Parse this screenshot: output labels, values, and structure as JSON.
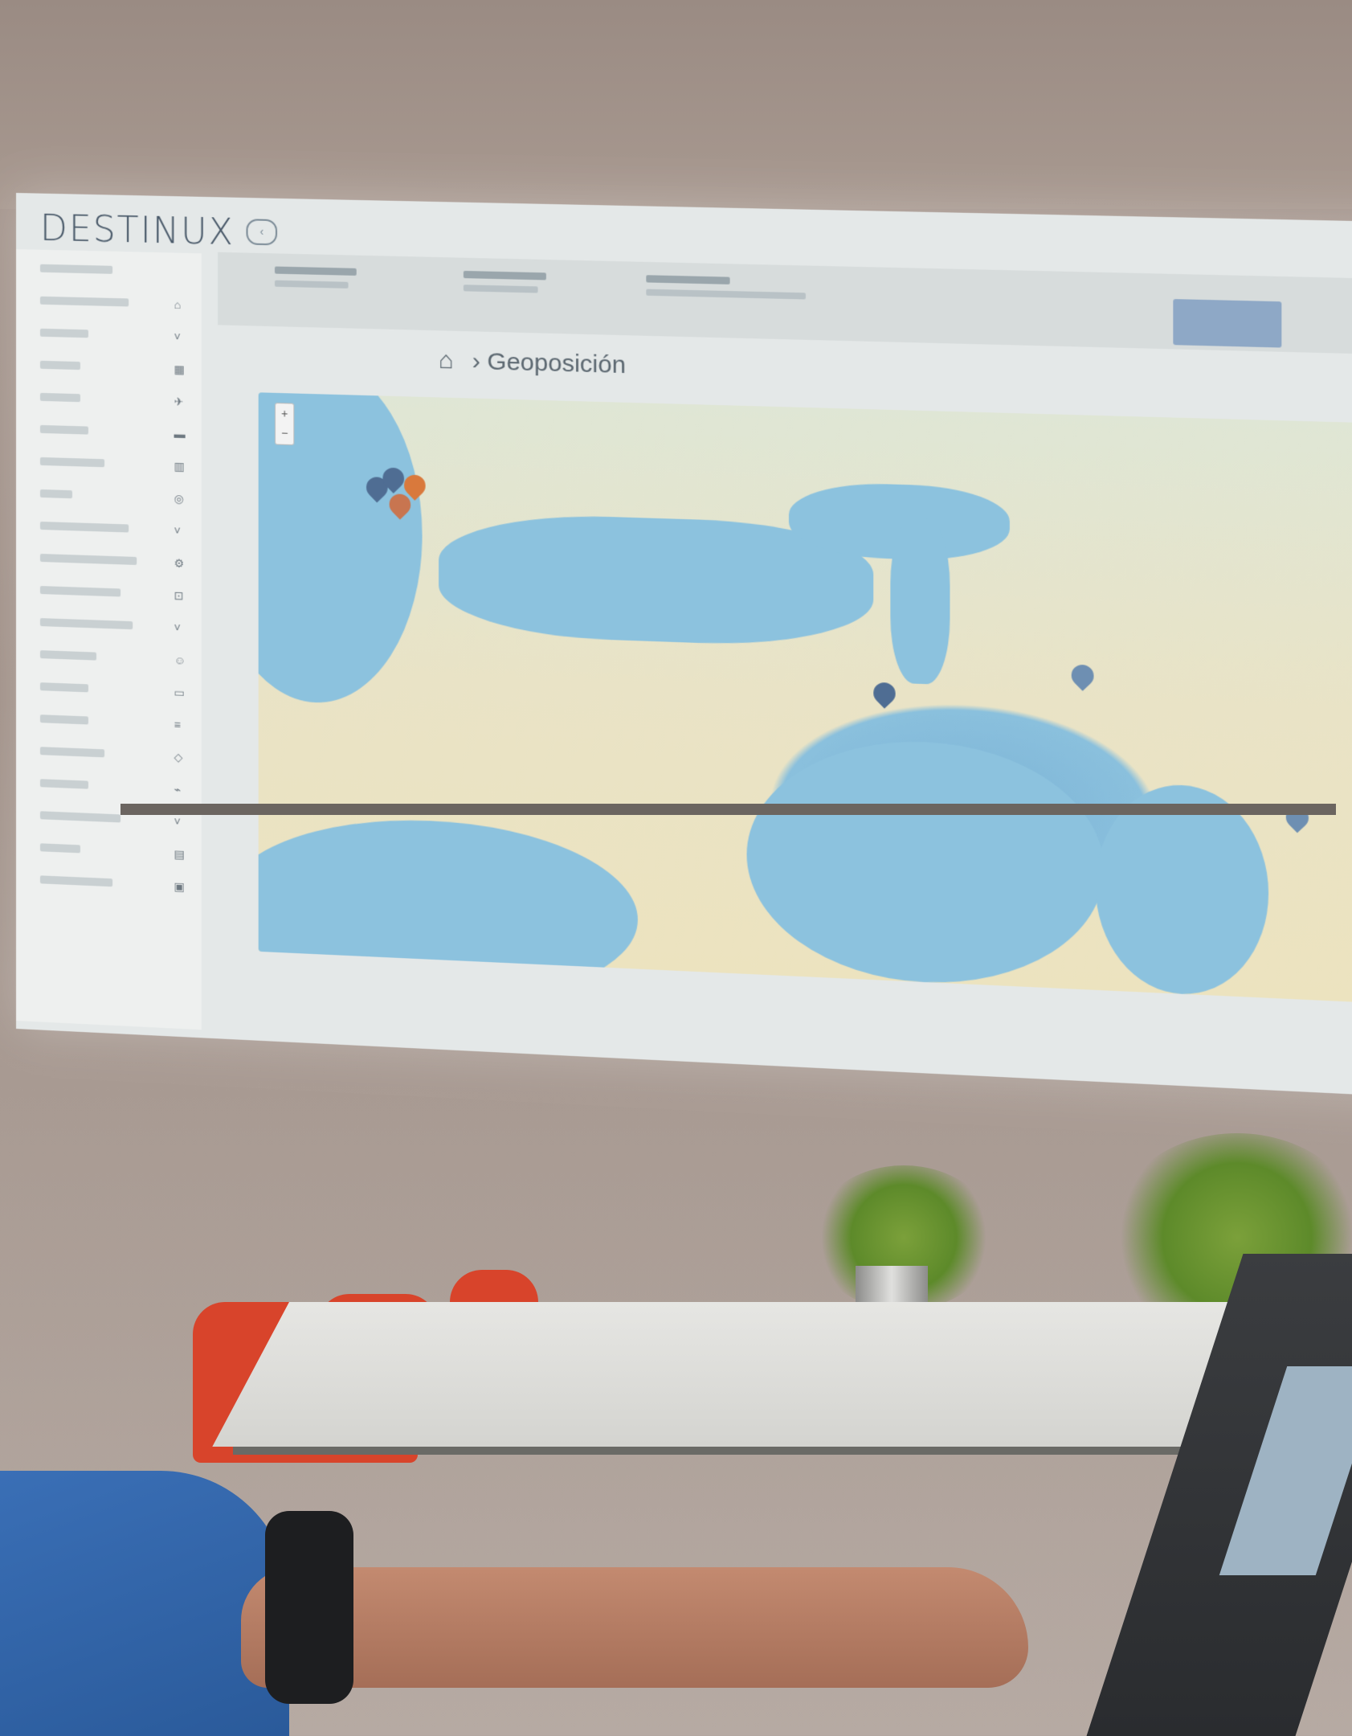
{
  "app": {
    "logo_text": "DESTINUX"
  },
  "breadcrumb": {
    "current": "Geoposición"
  },
  "map": {
    "zoom_in": "+",
    "zoom_out": "−"
  },
  "colors": {
    "accent_button": "#8ea8c6",
    "pin_blue": "#4f6d93",
    "pin_orange": "#d9793c",
    "chair_red": "#d8442b"
  }
}
